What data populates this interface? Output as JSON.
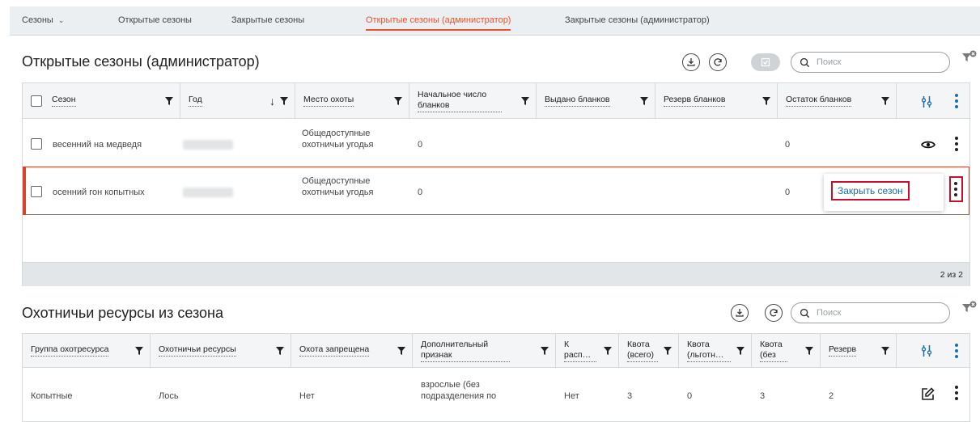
{
  "tabs": {
    "seasons_dropdown": "Сезоны",
    "open": "Открытые сезоны",
    "closed": "Закрытые сезоны",
    "open_admin": "Открытые сезоны (администратор)",
    "closed_admin": "Закрытые сезоны (администратор)"
  },
  "seasons_panel": {
    "title": "Открытые сезоны (администратор)",
    "search_placeholder": "Поиск",
    "columns": [
      "Сезон",
      "Год",
      "Место охоты",
      "Начальное число бланков",
      "Выдано бланков",
      "Резерв бланков",
      "Остаток бланков"
    ],
    "rows": [
      {
        "season": "весенний на медведя",
        "place": "Общедоступные охотничьи угодья",
        "initial": "0",
        "rest": "0"
      },
      {
        "season": "осенний гон копытных",
        "place": "Общедоступные охотничьи угодья",
        "initial": "0",
        "rest": "0"
      }
    ],
    "context_menu_item": "Закрыть сезон",
    "pagination": "2 из 2"
  },
  "resources_panel": {
    "title": "Охотничьи ресурсы из сезона",
    "search_placeholder": "Поиск",
    "columns": [
      "Группа охотресурса",
      "Охотничьи ресурсы",
      "Охота запрещена",
      "Дополнительный признак",
      "К расп…",
      "Квота (всего)",
      "Квота (льготн…",
      "Квота (без",
      "Резерв"
    ],
    "rows": [
      {
        "group": "Копытные",
        "resource": "Лось",
        "forbidden": "Нет",
        "extra": "взрослые (без подразделения по",
        "to_distribute": "Нет",
        "quota_total": "3",
        "quota_pref": "0",
        "quota_without": "3",
        "reserve": "2"
      }
    ]
  },
  "colors": {
    "accent": "#e8552d",
    "selected_border": "#d8432a",
    "highlight": "#c8102e",
    "link": "#1b6fa8"
  },
  "icons": [
    "chevron-down-icon",
    "download-icon",
    "refresh-icon",
    "check-icon",
    "search-icon",
    "filter-clear-icon",
    "filter-icon",
    "sort-down-icon",
    "column-settings-icon",
    "more-vert-icon",
    "eye-icon",
    "edit-icon"
  ]
}
